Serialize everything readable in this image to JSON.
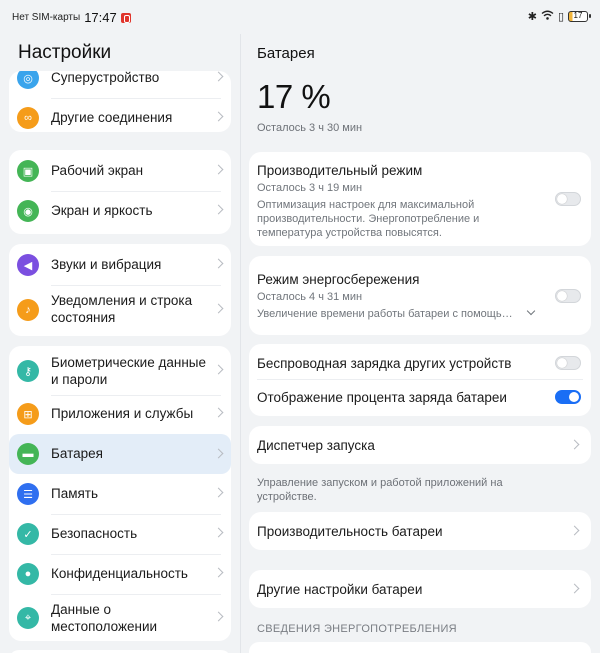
{
  "status_bar": {
    "carrier": "Нет SIM-карты",
    "time": "17:47",
    "battery_level": "17",
    "icons": [
      "bluetooth-icon",
      "wifi-icon",
      "vibrate-icon",
      "battery-icon"
    ]
  },
  "left": {
    "title": "Настройки",
    "groups": [
      {
        "items": [
          {
            "label": "Суперустройство",
            "icon": "super-device-icon",
            "color": "#3aa4ec"
          },
          {
            "label": "Другие соединения",
            "icon": "link-icon",
            "color": "#f59c1a"
          }
        ]
      },
      {
        "items": [
          {
            "label": "Рабочий экран",
            "icon": "home-screen-icon",
            "color": "#44b556"
          },
          {
            "label": "Экран и яркость",
            "icon": "eye-icon",
            "color": "#44b556"
          }
        ]
      },
      {
        "items": [
          {
            "label": "Звуки и вибрация",
            "icon": "speaker-icon",
            "color": "#7b4fe0"
          },
          {
            "label": "Уведомления и строка состояния",
            "icon": "bell-icon",
            "color": "#f59c1a"
          }
        ]
      },
      {
        "items": [
          {
            "label": "Биометрические данные и пароли",
            "icon": "key-icon",
            "color": "#34b8a6"
          },
          {
            "label": "Приложения и службы",
            "icon": "apps-grid-icon",
            "color": "#f59c1a"
          },
          {
            "label": "Батарея",
            "icon": "battery-icon",
            "color": "#44b556",
            "active": true
          },
          {
            "label": "Память",
            "icon": "storage-icon",
            "color": "#2f6ff0"
          },
          {
            "label": "Безопасность",
            "icon": "shield-icon",
            "color": "#34b8a6"
          },
          {
            "label": "Конфиденциальность",
            "icon": "privacy-icon",
            "color": "#34b8a6"
          },
          {
            "label": "Данные о местоположении",
            "icon": "location-pin-icon",
            "color": "#34b8a6"
          }
        ]
      }
    ]
  },
  "right": {
    "title": "Батарея",
    "percent": "17 %",
    "remaining": "Осталось 3 ч 30 мин",
    "perf_mode": {
      "title": "Производительный режим",
      "remaining": "Осталось 3 ч 19 мин",
      "description": "Оптимизация настроек для максимальной производительности. Энергопотребление и температура устройства повысятся.",
      "enabled": false
    },
    "power_save": {
      "title": "Режим энергосбережения",
      "remaining": "Осталось 4 ч 31 мин",
      "description": "Увеличение времени работы батареи с помощь…",
      "enabled": false
    },
    "wireless_charging": {
      "title": "Беспроводная зарядка других устройств",
      "enabled": false
    },
    "show_percent": {
      "title": "Отображение процента заряда батареи",
      "enabled": true
    },
    "launch_manager": {
      "title": "Диспетчер запуска",
      "note": "Управление запуском и работой приложений на устройстве."
    },
    "battery_performance": {
      "title": "Производительность батареи"
    },
    "other_settings": {
      "title": "Другие настройки батареи"
    },
    "section_header": "СВЕДЕНИЯ ЭНЕРГОПОТРЕБЛЕНИЯ"
  },
  "colors": {
    "accent": "#1a6ef5",
    "background": "#f1f3f5",
    "card": "#ffffff",
    "active_row": "#e3edf8"
  }
}
